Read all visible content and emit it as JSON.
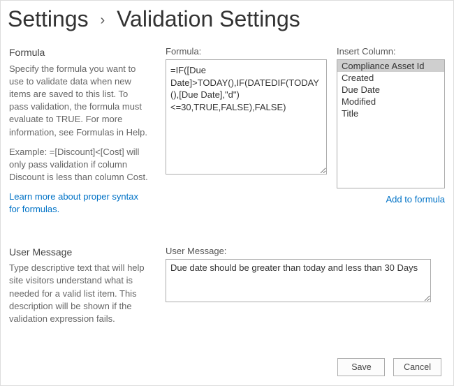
{
  "breadcrumb": {
    "parent": "Settings",
    "separator": "›",
    "current": "Validation Settings"
  },
  "formulaSection": {
    "title": "Formula",
    "descriptionA": "Specify the formula you want to use to validate data when new items are saved to this list. To pass validation, the formula must evaluate to TRUE. For more information, see Formulas in Help.",
    "descriptionB": "Example: =[Discount]<[Cost] will only pass validation if column Discount is less than column Cost.",
    "learnLink": "Learn more about proper syntax for formulas.",
    "formulaLabel": "Formula:",
    "formulaValue": "=IF([Due Date]>TODAY(),IF(DATEDIF(TODAY(),[Due Date],\"d\")<=30,TRUE,FALSE),FALSE)",
    "insertLabel": "Insert Column:",
    "columns": [
      "Compliance Asset Id",
      "Created",
      "Due Date",
      "Modified",
      "Title"
    ],
    "selectedColumnIndex": 0,
    "addToFormula": "Add to formula"
  },
  "userMessageSection": {
    "title": "User Message",
    "description": "Type descriptive text that will help site visitors understand what is needed for a valid list item. This description will be shown if the validation expression fails.",
    "label": "User Message:",
    "value": "Due date should be greater than today and less than 30 Days"
  },
  "buttons": {
    "save": "Save",
    "cancel": "Cancel"
  }
}
